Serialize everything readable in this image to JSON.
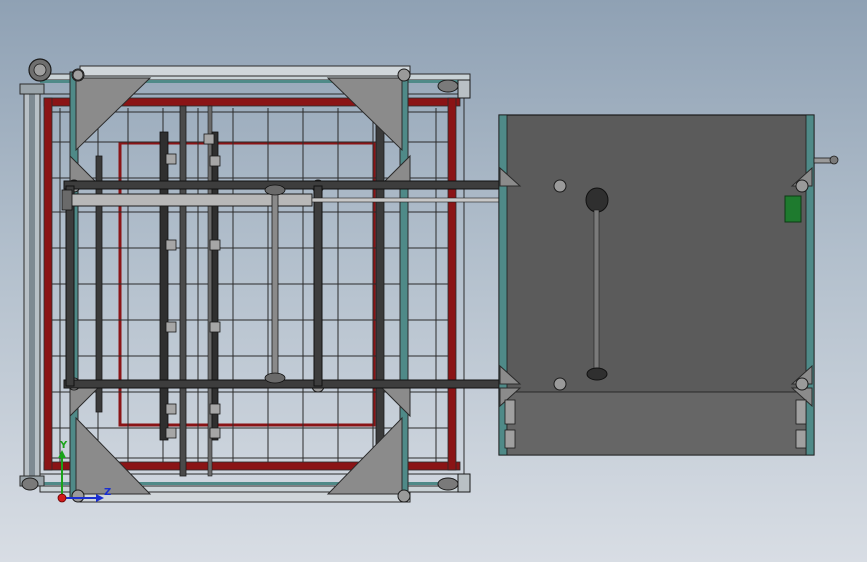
{
  "viewport": {
    "background_top": "#8fa1b4",
    "background_bottom": "#d8dde4"
  },
  "colors": {
    "frame_red": "#8a1416",
    "frame_dark": "#2b2b2b",
    "rail_teal": "#4f8a88",
    "rail_light": "#c9d2d6",
    "gusset_gray": "#8b8b8b",
    "panel_fill": "#5b5b5b",
    "bolt_gray": "#9a9a9a",
    "component_green": "#1e7a2e",
    "axis_x": "#d11a1a",
    "axis_y": "#1aa31a",
    "axis_z": "#1a2fd1"
  },
  "triad": {
    "y_label": "Y",
    "z_label": "Z"
  },
  "icons": {
    "motor": "motor-icon",
    "triad": "coordinate-triad-icon"
  }
}
